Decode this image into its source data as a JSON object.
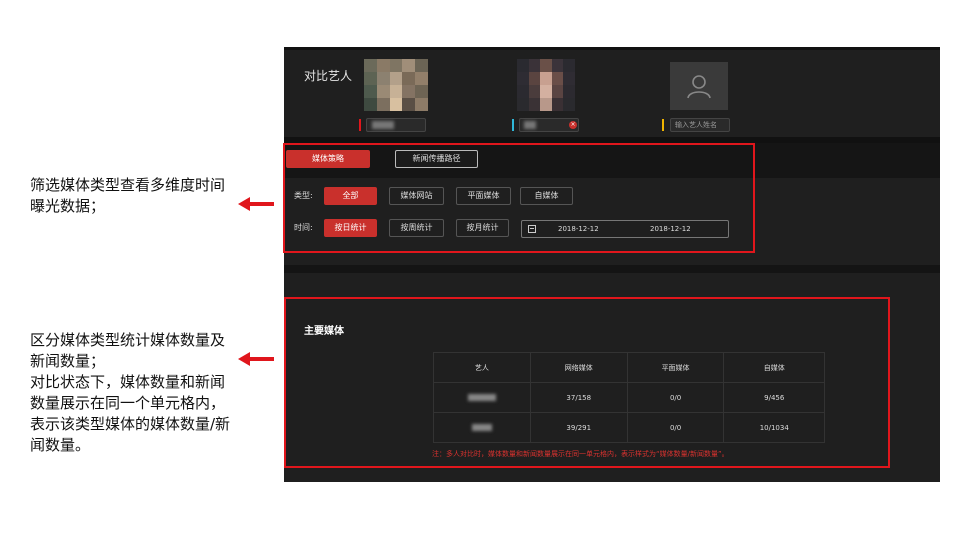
{
  "annotations": {
    "filter_note": "筛选媒体类型查看多维度时间\n曝光数据；",
    "table_note": "区分媒体类型统计媒体数量及\n新闻数量；\n对比状态下，媒体数量和新闻\n数量展示在同一个单元格内，\n表示该类型媒体的媒体数量/新\n闻数量。"
  },
  "compare": {
    "title": "对比艺人",
    "slot3_placeholder": "输入艺人姓名",
    "slot_colors": [
      "#e0161c",
      "#2fb7d8",
      "#f0b400"
    ]
  },
  "tabs": [
    "媒体策略",
    "新闻传播路径"
  ],
  "filters": {
    "type_label": "类型:",
    "type_options": [
      "全部",
      "媒体网站",
      "平面媒体",
      "自媒体"
    ],
    "time_label": "时间:",
    "time_options": [
      "按日统计",
      "按周统计",
      "按月统计"
    ],
    "date_start": "2018-12-12",
    "date_end": "2018-12-12"
  },
  "main_media": {
    "title": "主要媒体",
    "headers": [
      "艺人",
      "网络媒体",
      "平面媒体",
      "自媒体"
    ],
    "rows": [
      {
        "online": "37/158",
        "print": "0/0",
        "self": "9/456"
      },
      {
        "online": "39/291",
        "print": "0/0",
        "self": "10/1034"
      }
    ],
    "note": "注：多人对比时，媒体数量和新闻数量展示在同一单元格内，表示样式为“媒体数量/新闻数量”。"
  },
  "colors": {
    "accent": "#c9302c",
    "annotation_red": "#e0161c",
    "panel": "#1f1f1f"
  }
}
